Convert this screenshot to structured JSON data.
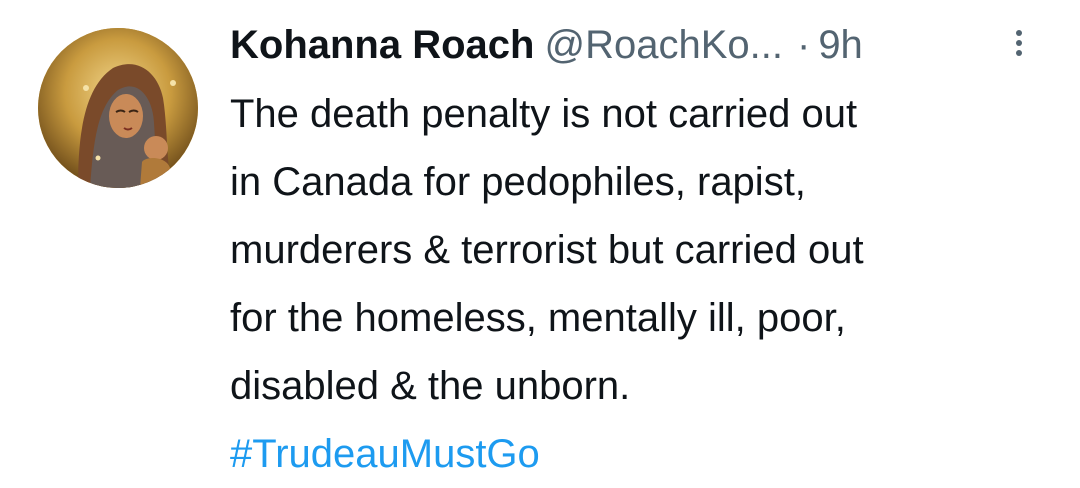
{
  "author": {
    "name": "Kohanna Roach",
    "handle": "@RoachKo...",
    "separator": "·",
    "time": "9h",
    "avatar_icon": "religious-icon-avatar"
  },
  "tweet": {
    "lines": [
      "The death penalty is not carried out",
      "in Canada for pedophiles, rapist,",
      "murderers & terrorist but carried out",
      "for the homeless, mentally ill, poor,",
      "disabled & the unborn."
    ],
    "hashtag": "#TrudeauMustGo"
  },
  "colors": {
    "text": "#0f1419",
    "secondary": "#536471",
    "link": "#1d9bf0",
    "background": "#ffffff"
  },
  "icons": {
    "more": "more-vertical-icon"
  }
}
